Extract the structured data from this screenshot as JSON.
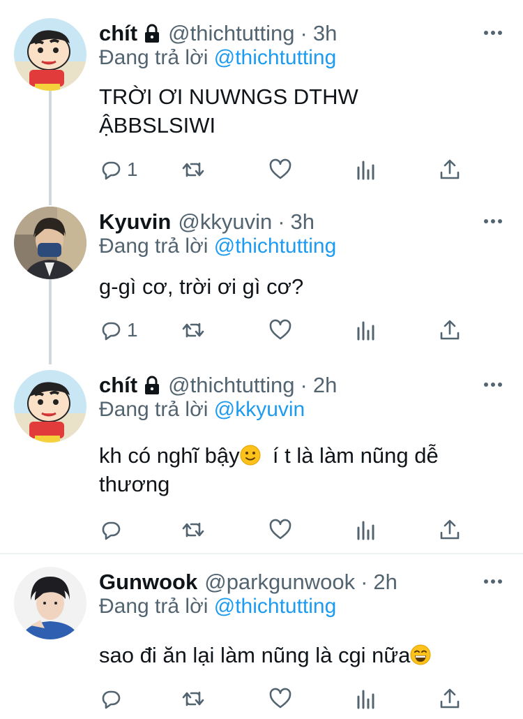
{
  "colors": {
    "accent": "#1d9bf0",
    "secondary": "#536471",
    "text": "#0f1419",
    "thread_line": "#cfd9de"
  },
  "tweets": [
    {
      "name": "chít",
      "locked": true,
      "handle": "@thichtutting",
      "separator": "·",
      "time": "3h",
      "reply_prefix": "Đang trả lời",
      "reply_to": "@thichtutting",
      "text_line1": "TRỜI ƠI NUWNGS DTHW",
      "text_line2": "ẬBBSLSIWI",
      "reply_count": "1",
      "avatar": "cartoon-avatar"
    },
    {
      "name": "Kyuvin",
      "locked": false,
      "handle": "@kkyuvin",
      "separator": "·",
      "time": "3h",
      "reply_prefix": "Đang trả lời",
      "reply_to": "@thichtutting",
      "text_line1": "g-gì cơ, trời ơi gì cơ?",
      "reply_count": "1",
      "avatar": "photo-avatar"
    },
    {
      "name": "chít",
      "locked": true,
      "handle": "@thichtutting",
      "separator": "·",
      "time": "2h",
      "reply_prefix": "Đang trả lời",
      "reply_to": "@kkyuvin",
      "text_part1": "kh có nghĩ bậy",
      "text_part2": "  í t là làm nũng dễ",
      "text_line2": "thương",
      "emoji": "slightly-smiling-face",
      "reply_count": "",
      "avatar": "cartoon-avatar"
    },
    {
      "name": "Gunwook",
      "locked": false,
      "handle": "@parkgunwook",
      "separator": "·",
      "time": "2h",
      "reply_prefix": "Đang trả lời",
      "reply_to": "@thichtutting",
      "text_part1": "sao đi ăn lại làm nũng là cgi nữa",
      "emoji": "grinning-face",
      "reply_count": "",
      "avatar": "photo-avatar"
    }
  ]
}
